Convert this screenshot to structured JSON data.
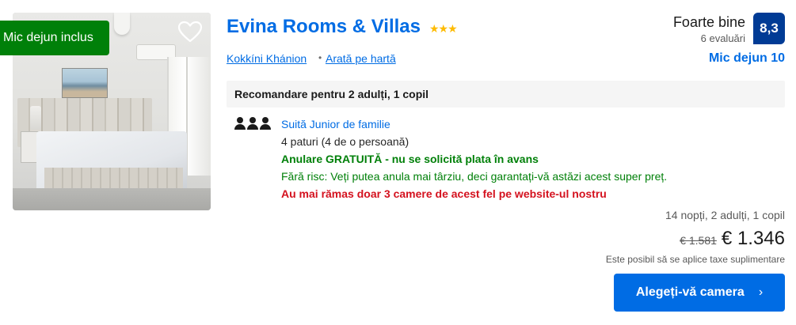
{
  "photo": {
    "badge": "Mic dejun inclus"
  },
  "hotel": {
    "name": "Evina Rooms & Villas",
    "stars": "★★★",
    "star_count": 3,
    "location": "Kokkíni Khánion",
    "separator": "•",
    "map_link": "Arată pe hartă"
  },
  "review": {
    "word": "Foarte bine",
    "count": "6 evaluări",
    "score": "8,3",
    "breakfast": "Mic dejun 10"
  },
  "recommendation": {
    "title": "Recomandare pentru 2 adulți, 1 copil",
    "room_name": "Suită Junior de familie",
    "beds": "4 paturi (4 de o persoană)",
    "cancellation": "Anulare GRATUITĂ - nu se solicită plata în avans",
    "no_risk": "Fără risc: Veți putea anula mai târziu, deci garantați-vă astăzi acest super preț.",
    "scarcity": "Au mai rămas doar 3 camere de acest fel pe website-ul nostru",
    "occupancy_icon_count": 3
  },
  "price": {
    "stay_info": "14 nopți, 2 adulți, 1 copil",
    "old": "€ 1.581",
    "current": "€ 1.346",
    "taxes": "Este posibil să se aplice taxe suplimentare"
  },
  "cta": {
    "label": "Alegeți-vă camera",
    "chevron": "›"
  },
  "colors": {
    "brand_blue": "#006ce4",
    "score_blue": "#003b95",
    "green": "#008009",
    "red": "#d4111e",
    "star_yellow": "#febb02"
  }
}
